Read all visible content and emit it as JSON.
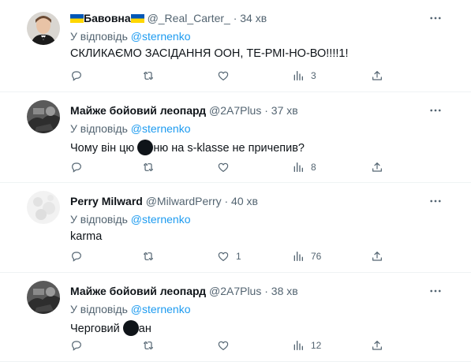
{
  "reply_prefix": "У відповідь",
  "colors": {
    "link": "#1d9bf0",
    "secondary": "#536471",
    "text": "#0f1419",
    "flag_blue": "#0057b7",
    "flag_yellow": "#ffd700"
  },
  "icons": {
    "reply": "reply-icon",
    "retweet": "retweet-icon",
    "like": "like-icon",
    "views": "views-icon",
    "share": "share-icon",
    "more": "more-icon"
  },
  "tweets": [
    {
      "name": "Бавовна",
      "handle": "@_Real_Carter_",
      "time": "· 34 хв",
      "reply_to": "@sternenko",
      "text": "СКЛИКАЄМО ЗАСІДАННЯ ООН, ТЕ-РМІ-НО-ВО!!!!1!",
      "likes": "",
      "views": "3"
    },
    {
      "name": "Майже бойовий леопард",
      "handle": "@2A7Plus",
      "time": "· 37 хв",
      "reply_to": "@sternenko",
      "text_before": "Чому він цю ",
      "text_after": "ню на s-klasse не причепив?",
      "likes": "",
      "views": "8"
    },
    {
      "name": "Perry Milward",
      "handle": "@MilwardPerry",
      "time": "· 40 хв",
      "reply_to": "@sternenko",
      "text": "karma",
      "likes": "1",
      "views": "76"
    },
    {
      "name": "Майже бойовий леопард",
      "handle": "@2A7Plus",
      "time": "· 38 хв",
      "reply_to": "@sternenko",
      "text_before": "Черговий ",
      "text_after": "ан",
      "likes": "",
      "views": "12"
    }
  ]
}
